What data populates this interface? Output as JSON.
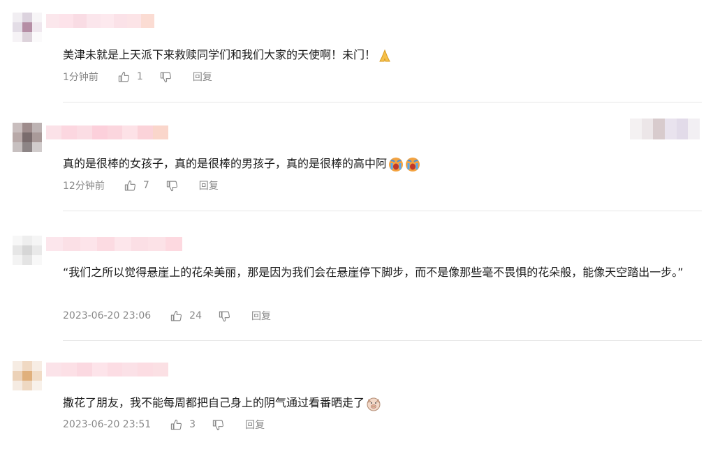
{
  "comments": [
    {
      "text": "美津未就是上天派下来救赎同学们和我们大家的天使啊！未门！",
      "emoji": "folded-hands",
      "time": "1分钟前",
      "likes": "1",
      "reply_label": "回复"
    },
    {
      "text": "真的是很棒的女孩子，真的是很棒的男孩子，真的是很棒的高中阿",
      "emoji": "crying-face x2",
      "time": "12分钟前",
      "likes": "7",
      "reply_label": "回复"
    },
    {
      "text": "“我们之所以觉得悬崖上的花朵美丽，那是因为我们会在悬崖停下脚步，而不是像那些毫不畏惧的花朵般，能像天空踏出一步。”",
      "time": "2023-06-20 23:06",
      "likes": "24",
      "reply_label": "回复"
    },
    {
      "text": "撒花了朋友，我不能每周都把自己身上的阴气通过看番晒走了",
      "emoji": "pig-face",
      "time": "2023-06-20 23:51",
      "likes": "3",
      "reply_label": "回复"
    }
  ],
  "colors": {
    "text": "#1a1a1a",
    "meta": "#888888",
    "divider": "#e6e6e6"
  }
}
